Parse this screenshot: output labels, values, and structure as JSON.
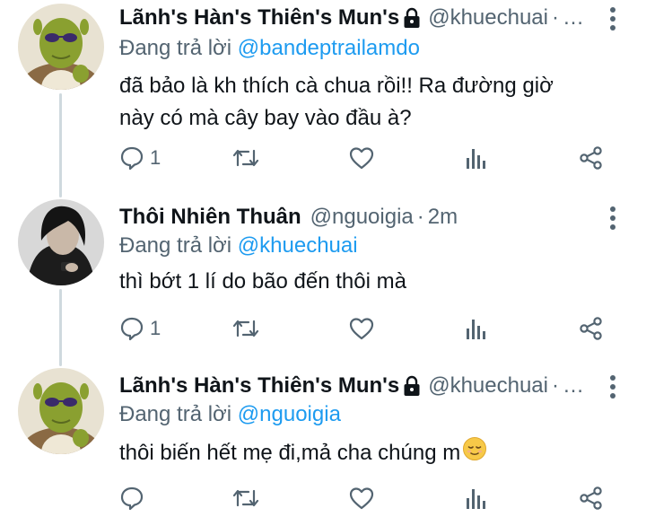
{
  "tweets": [
    {
      "display_name": "Lãnh's Hàn's Thiên's Mun's",
      "has_lock": true,
      "handle": "@khuechuai",
      "dot": "·",
      "time": "…",
      "replying_label": "Đang trả lời",
      "replying_to": "@bandeptrailamdo",
      "text_lines": [
        "đã bảo là kh thích cà chua rồi!! Ra đường giờ",
        "này có mà cây bay vào đầu à?"
      ],
      "reply_count": "1"
    },
    {
      "display_name": "Thôi Nhiên Thuân",
      "has_lock": false,
      "handle": "@nguoigia",
      "dot": "·",
      "time": "2m",
      "replying_label": "Đang trả lời",
      "replying_to": "@khuechuai",
      "text_lines": [
        "thì bớt 1 lí do bão đến thôi mà"
      ],
      "reply_count": "1"
    },
    {
      "display_name": "Lãnh's Hàn's Thiên's Mun's",
      "has_lock": true,
      "handle": "@khuechuai",
      "dot": "·",
      "time": "…",
      "replying_label": "Đang trả lời",
      "replying_to": "@nguoigia",
      "text_lines": [
        "thôi biến hết mẹ đi,mả cha chúng m"
      ],
      "reply_count": ""
    }
  ],
  "icons": {
    "reply": "speech-bubble-icon",
    "retweet": "retweet-icon",
    "like": "heart-icon",
    "views": "bar-chart-icon",
    "share": "share-icon",
    "more": "vertical-dots-icon",
    "lock": "lock-icon",
    "emoji": "relieved-face-emoji"
  },
  "colors": {
    "text": "#0f1419",
    "secondary": "#536471",
    "link": "#1d9bf0",
    "thread_line": "#cfd9de"
  }
}
